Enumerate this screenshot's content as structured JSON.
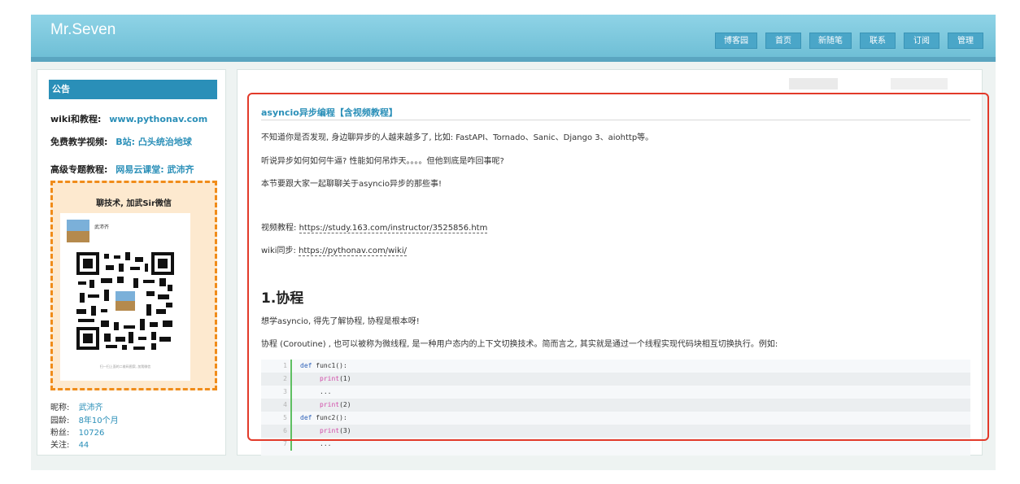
{
  "header": {
    "site_title": "Mr.Seven",
    "nav": [
      "博客园",
      "首页",
      "新随笔",
      "联系",
      "订阅",
      "管理"
    ]
  },
  "sidebar": {
    "heading": "公告",
    "wiki_label": "wiki和教程:",
    "wiki_link": "www.pythonav.com",
    "video_label": "免费教学视频:",
    "video_link": "B站: 凸头统治地球",
    "advanced_label": "高级专题教程:",
    "advanced_link": "网易云课堂: 武沛齐",
    "qr": {
      "caption": "聊技术, 加武Sir微信",
      "name": "武沛齐",
      "footnote": "扫一扫上面的二维码图案, 加我微信"
    },
    "profile": [
      {
        "label": "昵称:",
        "value": "武沛齐"
      },
      {
        "label": "园龄:",
        "value": "8年10个月"
      },
      {
        "label": "粉丝:",
        "value": "10726"
      },
      {
        "label": "关注:",
        "value": "44"
      }
    ]
  },
  "post": {
    "title": "asyncio异步编程【含视频教程】",
    "para1": "不知道你是否发现, 身边聊异步的人越来越多了, 比如: FastAPI、Tornado、Sanic、Django 3、aiohttp等。",
    "para2": "听说异步如何如何牛逼? 性能如何吊炸天。。。。但他到底是咋回事呢?",
    "para3": "本节要跟大家一起聊聊关于asyncio异步的那些事!",
    "video_label": "视频教程: ",
    "video_url": "https://study.163.com/instructor/3525856.htm",
    "wiki_label": "wiki同步: ",
    "wiki_url": "https://pythonav.com/wiki/",
    "section_heading": "1.协程",
    "para4": "想学asyncio, 得先了解协程, 协程是根本呀!",
    "para5": "协程 (Coroutine) , 也可以被称为微线程, 是一种用户态内的上下文切换技术。简而言之, 其实就是通过一个线程实现代码块相互切换执行。例如:",
    "code": [
      {
        "n": "1",
        "kw": "def",
        "text": " func1():"
      },
      {
        "n": "2",
        "fn": "print",
        "text": "(1)"
      },
      {
        "n": "3",
        "text": "..."
      },
      {
        "n": "4",
        "fn": "print",
        "text": "(2)"
      },
      {
        "n": "5",
        "kw": "def",
        "text": " func2():"
      },
      {
        "n": "6",
        "fn": "print",
        "text": "(3)"
      },
      {
        "n": "7",
        "text": "..."
      }
    ]
  },
  "colors": {
    "accent": "#2a8fb8",
    "highlight": "#e23a2a",
    "qr_border": "#f08c1a"
  }
}
